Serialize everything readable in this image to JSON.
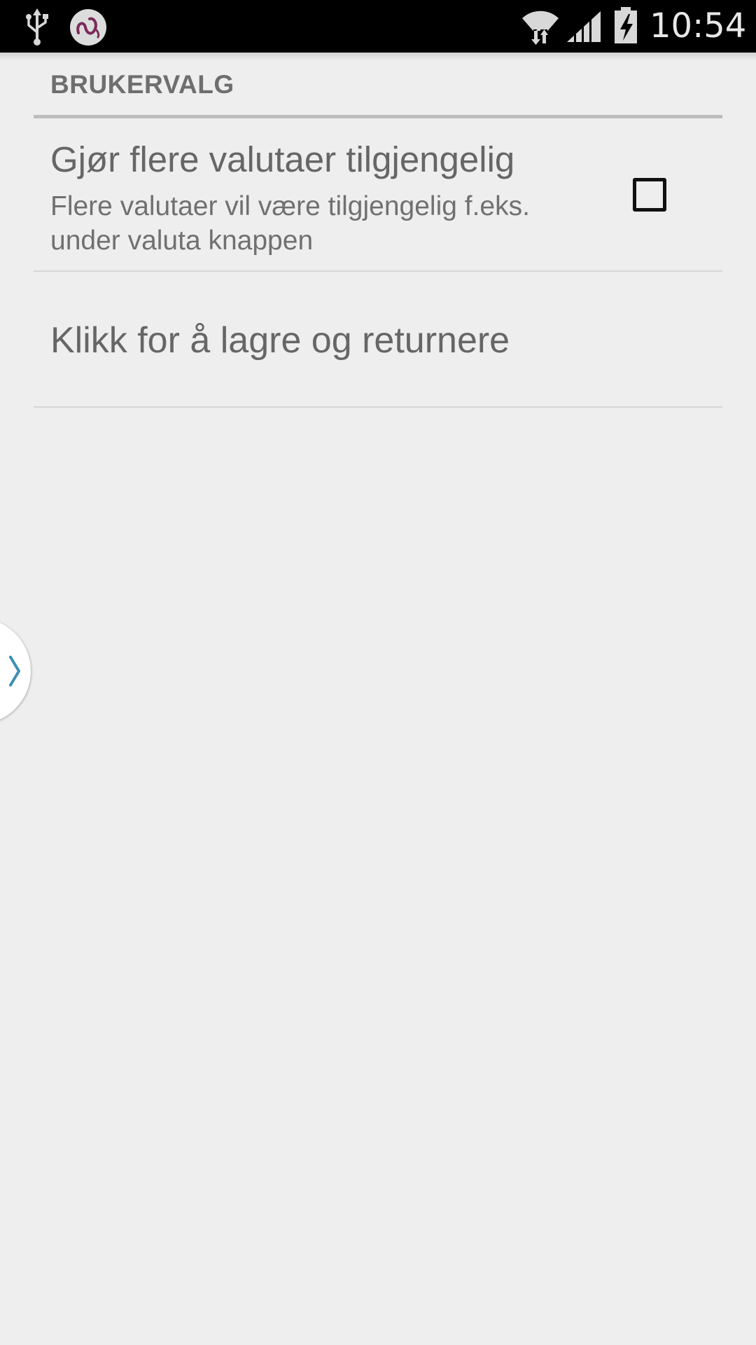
{
  "status_bar": {
    "time": "10:54",
    "icons": [
      "usb-icon",
      "app-notification-icon",
      "wifi-icon",
      "signal-icon",
      "battery-charging-icon"
    ]
  },
  "preferences": {
    "category_title": "BRUKERVALG",
    "currency_option": {
      "title": "Gjør flere valutaer tilgjengelig",
      "summary": "Flere valutaer vil være tilgjengelig f.eks. under valuta knappen",
      "checked": false
    },
    "save_label": "Klikk for å lagre og returnere"
  },
  "drawer_handle": {
    "icon": "chevron-right-icon"
  },
  "colors": {
    "background": "#eeeeee",
    "status_bar": "#000000",
    "accent_chevron": "#3d8fb3"
  }
}
